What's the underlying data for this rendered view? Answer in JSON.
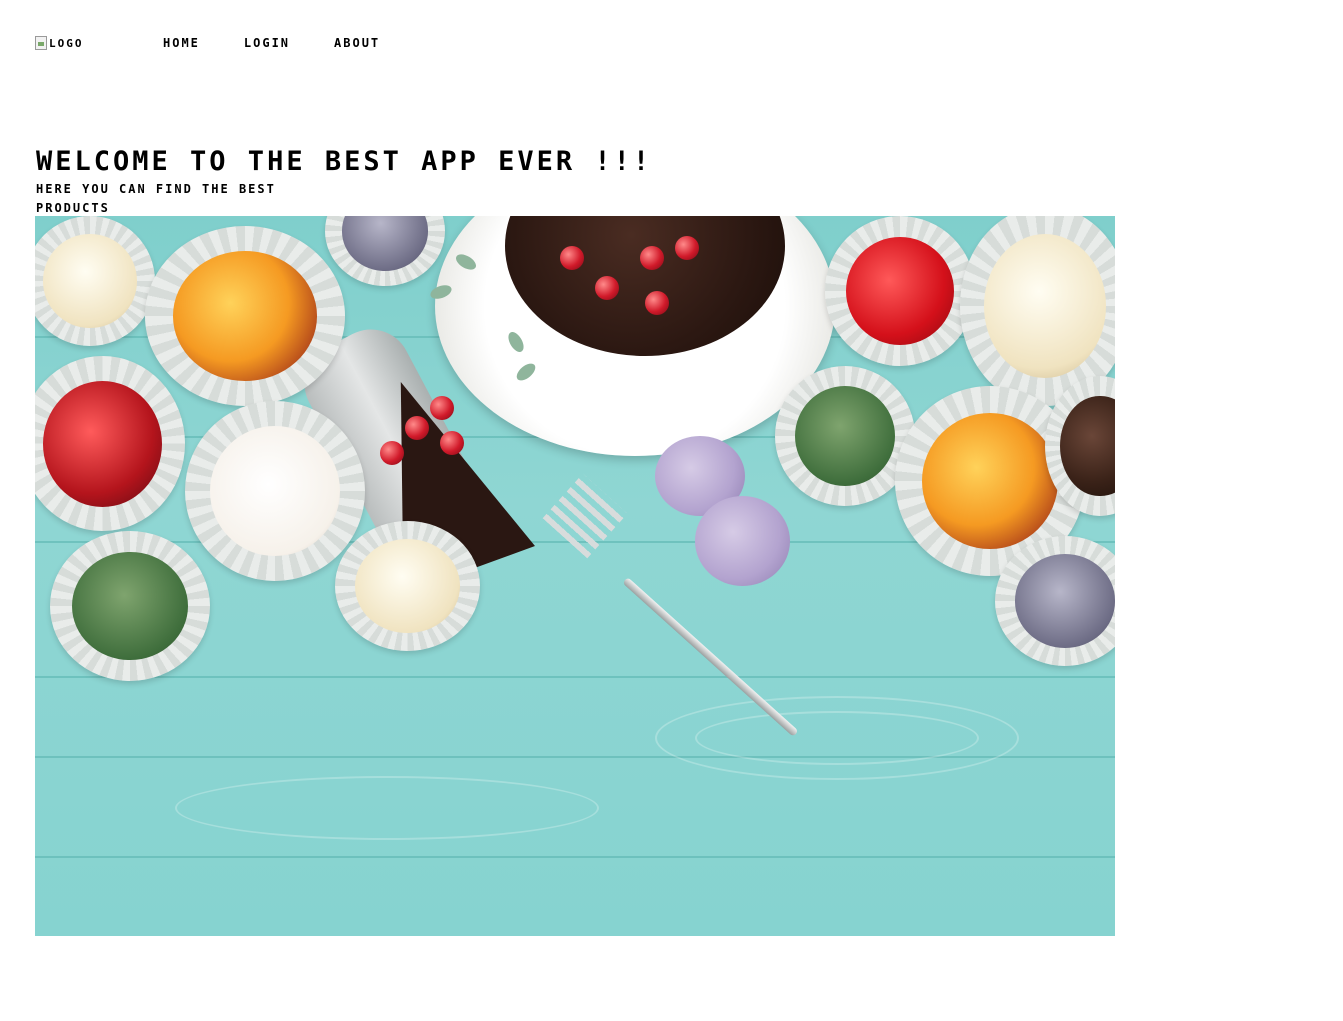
{
  "header": {
    "logo_alt": "Logo",
    "nav": [
      {
        "label": "Home"
      },
      {
        "label": "Login"
      },
      {
        "label": "About"
      }
    ]
  },
  "hero": {
    "title": "Welcome to the best app ever !!!",
    "subtitle": "Here you can find the best products"
  },
  "colors": {
    "background": "#ffffff",
    "text": "#000000",
    "table_teal": "#86d3d0"
  }
}
